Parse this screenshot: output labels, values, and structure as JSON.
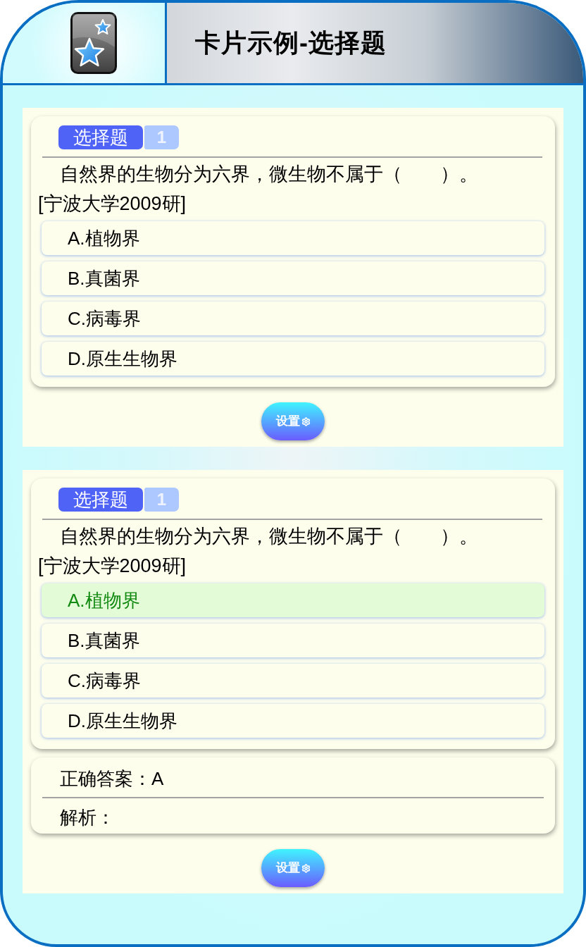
{
  "header": {
    "title": "卡片示例-选择题"
  },
  "cards": [
    {
      "tag": "选择题",
      "number": "1",
      "question": {
        "text": "自然界的生物分为六界，微生物不属于（　　）。",
        "source": "[宁波大学2009研]"
      },
      "options": [
        {
          "label": "A.植物界",
          "highlighted": false
        },
        {
          "label": "B.真菌界",
          "highlighted": false
        },
        {
          "label": "C.病毒界",
          "highlighted": false
        },
        {
          "label": "D.原生生物界",
          "highlighted": false
        }
      ],
      "settings_button": "设置"
    },
    {
      "tag": "选择题",
      "number": "1",
      "question": {
        "text": "自然界的生物分为六界，微生物不属于（　　）。",
        "source": "[宁波大学2009研]"
      },
      "options": [
        {
          "label": "A.植物界",
          "highlighted": true
        },
        {
          "label": "B.真菌界",
          "highlighted": false
        },
        {
          "label": "C.病毒界",
          "highlighted": false
        },
        {
          "label": "D.原生生物界",
          "highlighted": false
        }
      ],
      "answer": {
        "label": "正确答案：A",
        "explanation": "解析："
      },
      "settings_button": "设置"
    }
  ]
}
